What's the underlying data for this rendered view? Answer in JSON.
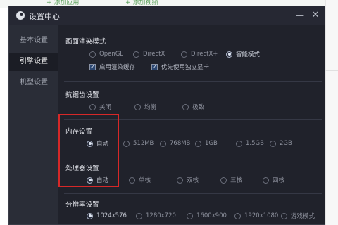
{
  "background": {
    "btn_add_app": "+ 添加应用",
    "btn_add_video": "+ 添加视频"
  },
  "window": {
    "title": "设置中心",
    "min": "—",
    "close": "✕"
  },
  "sidebar": {
    "items": [
      "基本设置",
      "引擎设置",
      "机型设置"
    ],
    "active_index": 1
  },
  "render": {
    "title": "画面渲染模式",
    "modes": [
      "OpenGL",
      "DirectX",
      "DirectX+",
      "智能模式"
    ],
    "selected": "智能模式",
    "checkboxes": [
      "启用渲染缓存",
      "优先使用独立显卡"
    ]
  },
  "aa": {
    "title": "抗锯齿设置",
    "options": [
      "关闭",
      "均衡",
      "极致"
    ],
    "selected": "极致"
  },
  "memory": {
    "title": "内存设置",
    "options": [
      "自动",
      "512MB",
      "768MB",
      "1GB",
      "1.5GB",
      "2GB"
    ],
    "selected": "自动"
  },
  "cpu": {
    "title": "处理器设置",
    "options": [
      "自动",
      "单核",
      "双核",
      "三核",
      "四核"
    ],
    "selected": "自动"
  },
  "resolution": {
    "title": "分辨率设置",
    "options": [
      "1024x576",
      "1280x720",
      "1600x900",
      "1920x1080",
      "游戏模式"
    ],
    "selected": "1024x576"
  },
  "colors": {
    "highlight": "#d62828",
    "accent": "#2b4670",
    "panel_bg": "#20222b"
  }
}
